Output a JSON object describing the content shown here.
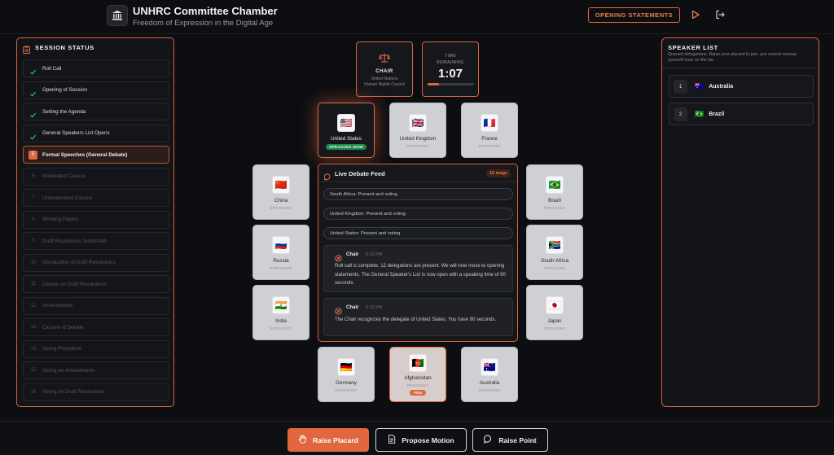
{
  "header": {
    "title": "UNHRC Committee Chamber",
    "subtitle": "Freedom of Expression in the Digital Age",
    "opening_button": "OPENING STATEMENTS",
    "icons": [
      "landmark-icon",
      "play-icon",
      "logout-icon"
    ]
  },
  "session": {
    "title": "SESSION STATUS",
    "steps": [
      {
        "num": "1",
        "label": "Roll Call",
        "state": "done"
      },
      {
        "num": "2",
        "label": "Opening of Session",
        "state": "done"
      },
      {
        "num": "3",
        "label": "Setting the Agenda",
        "state": "done"
      },
      {
        "num": "4",
        "label": "General Speakers List Opens",
        "state": "done"
      },
      {
        "num": "5",
        "label": "Formal Speeches (General Debate)",
        "state": "active"
      },
      {
        "num": "6",
        "label": "Moderated Caucus",
        "state": "pending"
      },
      {
        "num": "7",
        "label": "Unmoderated Caucus",
        "state": "pending"
      },
      {
        "num": "8",
        "label": "Working Papers",
        "state": "pending"
      },
      {
        "num": "9",
        "label": "Draft Resolutions Submitted",
        "state": "pending"
      },
      {
        "num": "10",
        "label": "Introduction of Draft Resolutions",
        "state": "pending"
      },
      {
        "num": "11",
        "label": "Debate on Draft Resolutions",
        "state": "pending"
      },
      {
        "num": "12",
        "label": "Amendments",
        "state": "pending"
      },
      {
        "num": "13",
        "label": "Closure of Debate",
        "state": "pending"
      },
      {
        "num": "14",
        "label": "Voting Procedure",
        "state": "pending"
      },
      {
        "num": "15",
        "label": "Voting on Amendments",
        "state": "pending"
      },
      {
        "num": "16",
        "label": "Voting on Draft Resolutions",
        "state": "pending"
      }
    ]
  },
  "chair": {
    "label": "CHAIR",
    "org": "United Nations Human Rights Council"
  },
  "timer": {
    "label": "TIME REMAINING",
    "value": "1:07",
    "progress": 0.25
  },
  "seats": {
    "us": {
      "name": "United States",
      "status": "SPEAKING NOW",
      "flag": "🇺🇸"
    },
    "uk": {
      "name": "United Kingdom",
      "status": "SPEAKING",
      "flag": "🇬🇧"
    },
    "france": {
      "name": "France",
      "status": "SPEAKING",
      "flag": "🇫🇷"
    },
    "china": {
      "name": "China",
      "status": "SPEAKING",
      "flag": "🇨🇳"
    },
    "russia": {
      "name": "Russia",
      "status": "SPEAKING",
      "flag": "🇷🇺"
    },
    "india": {
      "name": "India",
      "status": "SPEAKING",
      "flag": "🇮🇳"
    },
    "brazil": {
      "name": "Brazil",
      "status": "SPEAKING",
      "flag": "🇧🇷"
    },
    "south_africa": {
      "name": "South Africa",
      "status": "SPEAKING",
      "flag": "🇿🇦"
    },
    "japan": {
      "name": "Japan",
      "status": "SPEAKING",
      "flag": "🇯🇵"
    },
    "germany": {
      "name": "Germany",
      "status": "SPEAKING",
      "flag": "🇩🇪"
    },
    "afghanistan": {
      "name": "Afghanistan",
      "status": "SPEAKING",
      "flag": "🇦🇫",
      "badge": "YOU"
    },
    "australia": {
      "name": "Australia",
      "status": "SPEAKING",
      "flag": "🇦🇺"
    }
  },
  "feed": {
    "title": "Live Debate Feed",
    "count": "16 msgs",
    "pills": [
      "South Africa: Present and voting",
      "United Kingdom: Present and voting",
      "United States: Present and voting"
    ],
    "messages": [
      {
        "who": "Chair",
        "time": "6:13 PM",
        "text": "Roll call is complete. 12 delegations are present. We will now move to opening statements. The General Speaker's List is now open with a speaking time of 90 seconds."
      },
      {
        "who": "Chair",
        "time": "6:13 PM",
        "text": "The Chair recognizes the delegate of United States. You have 90 seconds."
      }
    ]
  },
  "speaker_list": {
    "title": "SPEAKER LIST",
    "description": "Queued delegations. Raise your placard to join; you cannot remove yourself once on the list.",
    "items": [
      {
        "num": "1",
        "name": "Australia",
        "flag": "🇦🇺"
      },
      {
        "num": "2",
        "name": "Brazil",
        "flag": "🇧🇷"
      }
    ]
  },
  "actions": {
    "raise_placard": "Raise Placard",
    "propose_motion": "Propose Motion",
    "raise_point": "Raise Point"
  },
  "colors": {
    "accent": "#e0673f",
    "speaking_green": "#1e8a4c",
    "background": "#0d0e11"
  }
}
